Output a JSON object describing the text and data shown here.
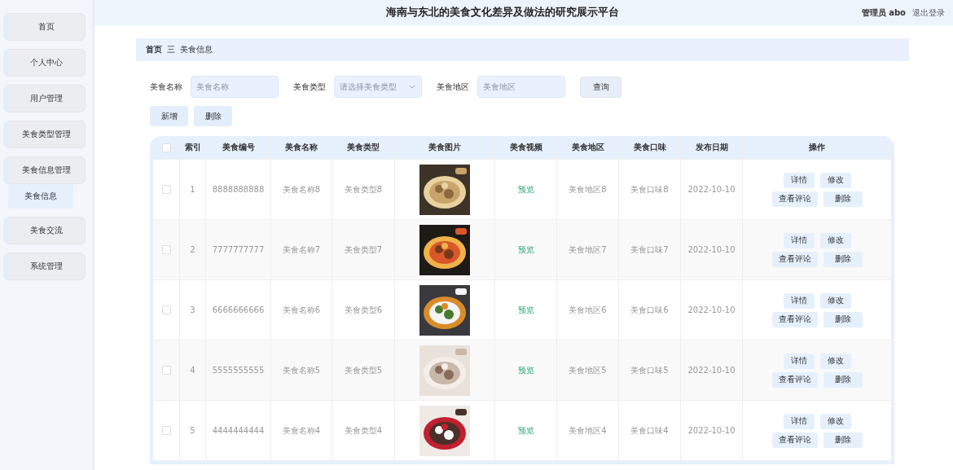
{
  "header": {
    "title": "海南与东北的美食文化差异及做法的研究展示平台",
    "user": "管理员 abo",
    "logout": "退出登录"
  },
  "sidebar": {
    "items": [
      {
        "label": "首页",
        "selected": false
      },
      {
        "label": "个人中心",
        "selected": false
      },
      {
        "label": "用户管理",
        "selected": false
      },
      {
        "label": "美食类型管理",
        "selected": false
      },
      {
        "label": "美食信息管理",
        "selected": false,
        "children": [
          {
            "label": "美食信息",
            "selected": true
          }
        ]
      },
      {
        "label": "美食交流",
        "selected": false
      },
      {
        "label": "系统管理",
        "selected": false
      }
    ]
  },
  "breadcrumb": [
    "首页",
    "美食信息"
  ],
  "breadcrumb_separator": "三",
  "search": {
    "fields": [
      {
        "kind": "input",
        "label": "美食名称",
        "placeholder": "美食名称"
      },
      {
        "kind": "select",
        "label": "美食类型",
        "placeholder": "请选择美食类型"
      },
      {
        "kind": "input",
        "label": "美食地区",
        "placeholder": "美食地区"
      }
    ],
    "button": "查询"
  },
  "actions": [
    "新增",
    "删除"
  ],
  "table": {
    "header_checked": false,
    "columns": [
      "索引",
      "美食编号",
      "美食名称",
      "美食类型",
      "美食图片",
      "美食视频",
      "美食地区",
      "美食口味",
      "发布日期",
      "操作"
    ],
    "rows": [
      {
        "checked": false,
        "index": "1",
        "code": "8888888888",
        "name": "美食名称8",
        "type": "美食类型8",
        "video": "预览",
        "region": "美食地区8",
        "taste": "美食口味8",
        "date": "2022-10-10",
        "buttons": [
          "详情",
          "修改",
          "查看评论",
          "删除"
        ]
      },
      {
        "checked": false,
        "index": "2",
        "code": "7777777777",
        "name": "美食名称7",
        "type": "美食类型7",
        "video": "预览",
        "region": "美食地区7",
        "taste": "美食口味7",
        "date": "2022-10-10",
        "buttons": [
          "详情",
          "修改",
          "查看评论",
          "删除"
        ]
      },
      {
        "checked": false,
        "index": "3",
        "code": "6666666666",
        "name": "美食名称6",
        "type": "美食类型6",
        "video": "预览",
        "region": "美食地区6",
        "taste": "美食口味6",
        "date": "2022-10-10",
        "buttons": [
          "详情",
          "修改",
          "查看评论",
          "删除"
        ]
      },
      {
        "checked": false,
        "index": "4",
        "code": "5555555555",
        "name": "美食名称5",
        "type": "美食类型5",
        "video": "预览",
        "region": "美食地区5",
        "taste": "美食口味5",
        "date": "2022-10-10",
        "buttons": [
          "详情",
          "修改",
          "查看评论",
          "删除"
        ]
      },
      {
        "checked": false,
        "index": "5",
        "code": "4444444444",
        "name": "美食名称4",
        "type": "美食类型4",
        "video": "预览",
        "region": "美食地区4",
        "taste": "美食口味4",
        "date": "2022-10-10",
        "buttons": [
          "详情",
          "修改",
          "查看评论",
          "删除"
        ]
      }
    ]
  }
}
